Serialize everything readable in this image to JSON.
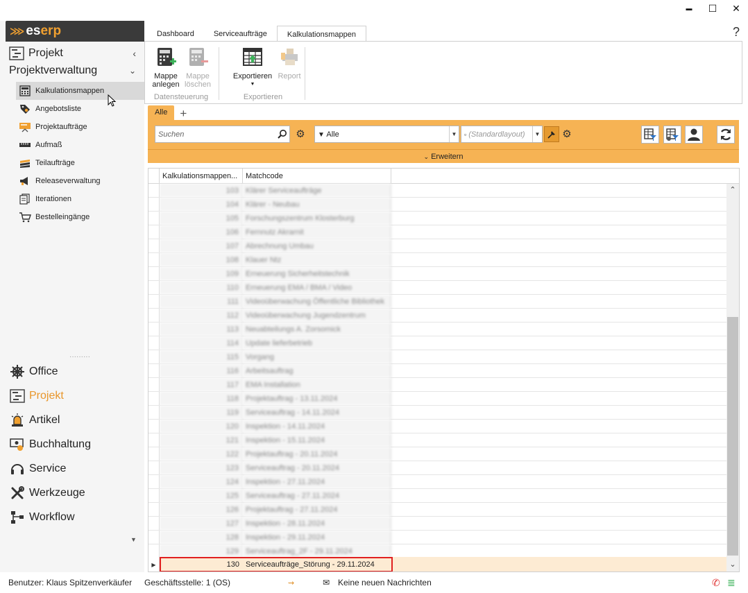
{
  "window": {
    "minimize": "▬",
    "maximize": "☐",
    "close": "✕",
    "help": "?"
  },
  "logo": {
    "es": "es",
    "erp": "erp"
  },
  "sidebar": {
    "header": "Projekt",
    "section": "Projektverwaltung",
    "items": [
      {
        "label": "Kalkulationsmappen",
        "icon": "calculator-icon"
      },
      {
        "label": "Angebotsliste",
        "icon": "price-tag-icon"
      },
      {
        "label": "Projektaufträge",
        "icon": "presentation-icon"
      },
      {
        "label": "Aufmaß",
        "icon": "ruler-icon"
      },
      {
        "label": "Teilaufträge",
        "icon": "stack-icon"
      },
      {
        "label": "Releaseverwaltung",
        "icon": "megaphone-icon"
      },
      {
        "label": "Iterationen",
        "icon": "documents-icon"
      },
      {
        "label": "Bestelleingänge",
        "icon": "cart-icon"
      }
    ],
    "modules": [
      {
        "label": "Office",
        "icon": "helm-icon"
      },
      {
        "label": "Projekt",
        "icon": "gantt-icon"
      },
      {
        "label": "Artikel",
        "icon": "alarm-light-icon"
      },
      {
        "label": "Buchhaltung",
        "icon": "money-icon"
      },
      {
        "label": "Service",
        "icon": "headset-icon"
      },
      {
        "label": "Werkzeuge",
        "icon": "tools-icon"
      },
      {
        "label": "Workflow",
        "icon": "workflow-icon"
      }
    ]
  },
  "tabs": [
    "Dashboard",
    "Serviceaufträge",
    "Kalkulationsmappen"
  ],
  "ribbon": {
    "group1_label": "Datensteuerung",
    "group2_label": "Exportieren",
    "btn_new_l1": "Mappe",
    "btn_new_l2": "anlegen",
    "btn_del_l1": "Mappe",
    "btn_del_l2": "löschen",
    "btn_export": "Exportieren",
    "btn_report": "Report"
  },
  "filter": {
    "tab": "Alle",
    "add": "+",
    "search_placeholder": "Suchen",
    "filter_value": "Alle",
    "layout_value": "(Standardlayout)",
    "expand": "Erweitern"
  },
  "grid": {
    "columns": [
      "Kalkulationsmappen...",
      "Matchcode"
    ],
    "rows": [
      {
        "nr": "103",
        "code": "Klärer Serviceaufträge"
      },
      {
        "nr": "104",
        "code": "Klärer - Neubau"
      },
      {
        "nr": "105",
        "code": "Forschungszentrum Klosterburg"
      },
      {
        "nr": "106",
        "code": "Fernnutz Akrarnit"
      },
      {
        "nr": "107",
        "code": "Abrechnung Umbau"
      },
      {
        "nr": "108",
        "code": "Klauer Ntz"
      },
      {
        "nr": "109",
        "code": "Erneuerung Sicherheitstechnik"
      },
      {
        "nr": "110",
        "code": "Erneuerung EMA / BMA / Video"
      },
      {
        "nr": "111",
        "code": "Videoüberwachung Öffentliche Bibliothek"
      },
      {
        "nr": "112",
        "code": "Videoüberwachung Jugendzentrum"
      },
      {
        "nr": "113",
        "code": "Neuabteilungs A. Zorsomick"
      },
      {
        "nr": "114",
        "code": "Update lieferbetrieb"
      },
      {
        "nr": "115",
        "code": "Vorgang"
      },
      {
        "nr": "116",
        "code": "Arbeitsauftrag"
      },
      {
        "nr": "117",
        "code": "EMA Installation"
      },
      {
        "nr": "118",
        "code": "Projektauftrag - 13.11.2024"
      },
      {
        "nr": "119",
        "code": "Serviceauftrag - 14.11.2024"
      },
      {
        "nr": "120",
        "code": "Inspektion - 14.11.2024"
      },
      {
        "nr": "121",
        "code": "Inspektion - 15.11.2024"
      },
      {
        "nr": "122",
        "code": "Projektauftrag - 20.11.2024"
      },
      {
        "nr": "123",
        "code": "Serviceauftrag - 20.11.2024"
      },
      {
        "nr": "124",
        "code": "Inspektion - 27.11.2024"
      },
      {
        "nr": "125",
        "code": "Serviceauftrag - 27.11.2024"
      },
      {
        "nr": "126",
        "code": "Projektauftrag - 27.11.2024"
      },
      {
        "nr": "127",
        "code": "Inspektion - 28.11.2024"
      },
      {
        "nr": "128",
        "code": "Inspektion - 29.11.2024"
      },
      {
        "nr": "129",
        "code": "Serviceauftrag_2F - 29.11.2024"
      }
    ],
    "selected": {
      "nr": "130",
      "code": "Serviceaufträge_Störung - 29.11.2024"
    }
  },
  "status": {
    "user": "Benutzer: Klaus Spitzenverkäufer",
    "office": "Geschäftsstelle: 1 (OS)",
    "messages": "Keine neuen Nachrichten"
  },
  "colors": {
    "accent": "#f6b354",
    "brand_orange": "#e8962a",
    "selection_border": "#e02020"
  }
}
